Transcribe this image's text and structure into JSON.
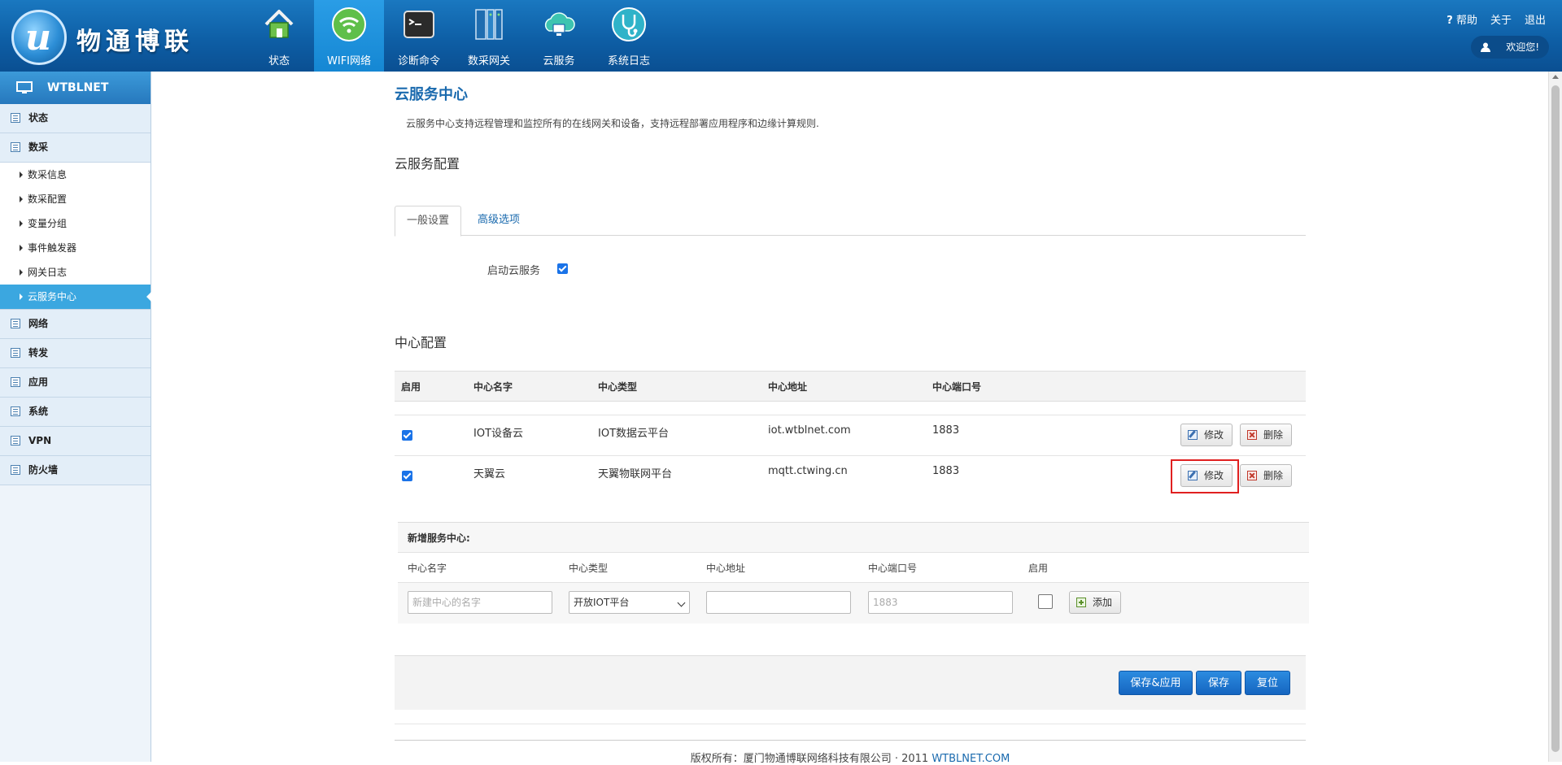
{
  "header": {
    "logo_mark": "u",
    "logo_text": "物通博联",
    "nav": [
      {
        "label": "状态",
        "icon": "home-icon"
      },
      {
        "label": "WIFI网络",
        "icon": "wifi-icon"
      },
      {
        "label": "诊断命令",
        "icon": "terminal-icon"
      },
      {
        "label": "数采网关",
        "icon": "server-icon"
      },
      {
        "label": "云服务",
        "icon": "cloud-icon"
      },
      {
        "label": "系统日志",
        "icon": "stethoscope-icon"
      }
    ],
    "active_nav": "WIFI网络",
    "help": "帮助",
    "about": "关于",
    "logout": "退出",
    "welcome": "欢迎您!"
  },
  "sidebar": {
    "title": "WTBLNET",
    "groups_top": [
      {
        "label": "状态"
      },
      {
        "label": "数采"
      }
    ],
    "subitems": [
      {
        "label": "数采信息"
      },
      {
        "label": "数采配置"
      },
      {
        "label": "变量分组"
      },
      {
        "label": "事件触发器"
      },
      {
        "label": "网关日志"
      },
      {
        "label": "云服务中心"
      }
    ],
    "active_sub": "云服务中心",
    "groups_bottom": [
      {
        "label": "网络"
      },
      {
        "label": "转发"
      },
      {
        "label": "应用"
      },
      {
        "label": "系统"
      },
      {
        "label": "VPN"
      },
      {
        "label": "防火墙"
      }
    ]
  },
  "main": {
    "title": "云服务中心",
    "description": "云服务中心支持远程管理和监控所有的在线网关和设备，支持远程部署应用程序和边缘计算规则.",
    "config_section": "云服务配置",
    "tabs": [
      {
        "label": "一般设置"
      },
      {
        "label": "高级选项"
      }
    ],
    "enable_cloud_label": "启动云服务",
    "enable_cloud": true,
    "center_section": "中心配置",
    "table": {
      "headers": [
        "启用",
        "中心名字",
        "中心类型",
        "中心地址",
        "中心端口号"
      ],
      "rows": [
        {
          "enabled": true,
          "name": "IOT设备云",
          "type": "IOT数据云平台",
          "address": "iot.wtblnet.com",
          "port": "1883"
        },
        {
          "enabled": true,
          "name": "天翼云",
          "type": "天翼物联网平台",
          "address": "mqtt.ctwing.cn",
          "port": "1883"
        }
      ],
      "edit_label": "修改",
      "delete_label": "删除"
    },
    "new_center": {
      "title": "新增服务中心:",
      "headers": [
        "中心名字",
        "中心类型",
        "中心地址",
        "中心端口号",
        "启用"
      ],
      "name_placeholder": "新建中心的名字",
      "type_value": "开放IOT平台",
      "address_value": "",
      "port_placeholder": "1883",
      "enabled": false,
      "add_label": "添加"
    },
    "actions": {
      "save_apply": "保存&应用",
      "save": "保存",
      "reset": "复位"
    },
    "footer": {
      "text": "版权所有：厦门物通博联网络科技有限公司 · 2011",
      "link": "WTBLNET.COM"
    }
  },
  "colors": {
    "header_blue": "#0e5fa6",
    "accent": "#1a6aae",
    "active_sidebar": "#3ba7e0",
    "highlight_box": "#e02020"
  }
}
